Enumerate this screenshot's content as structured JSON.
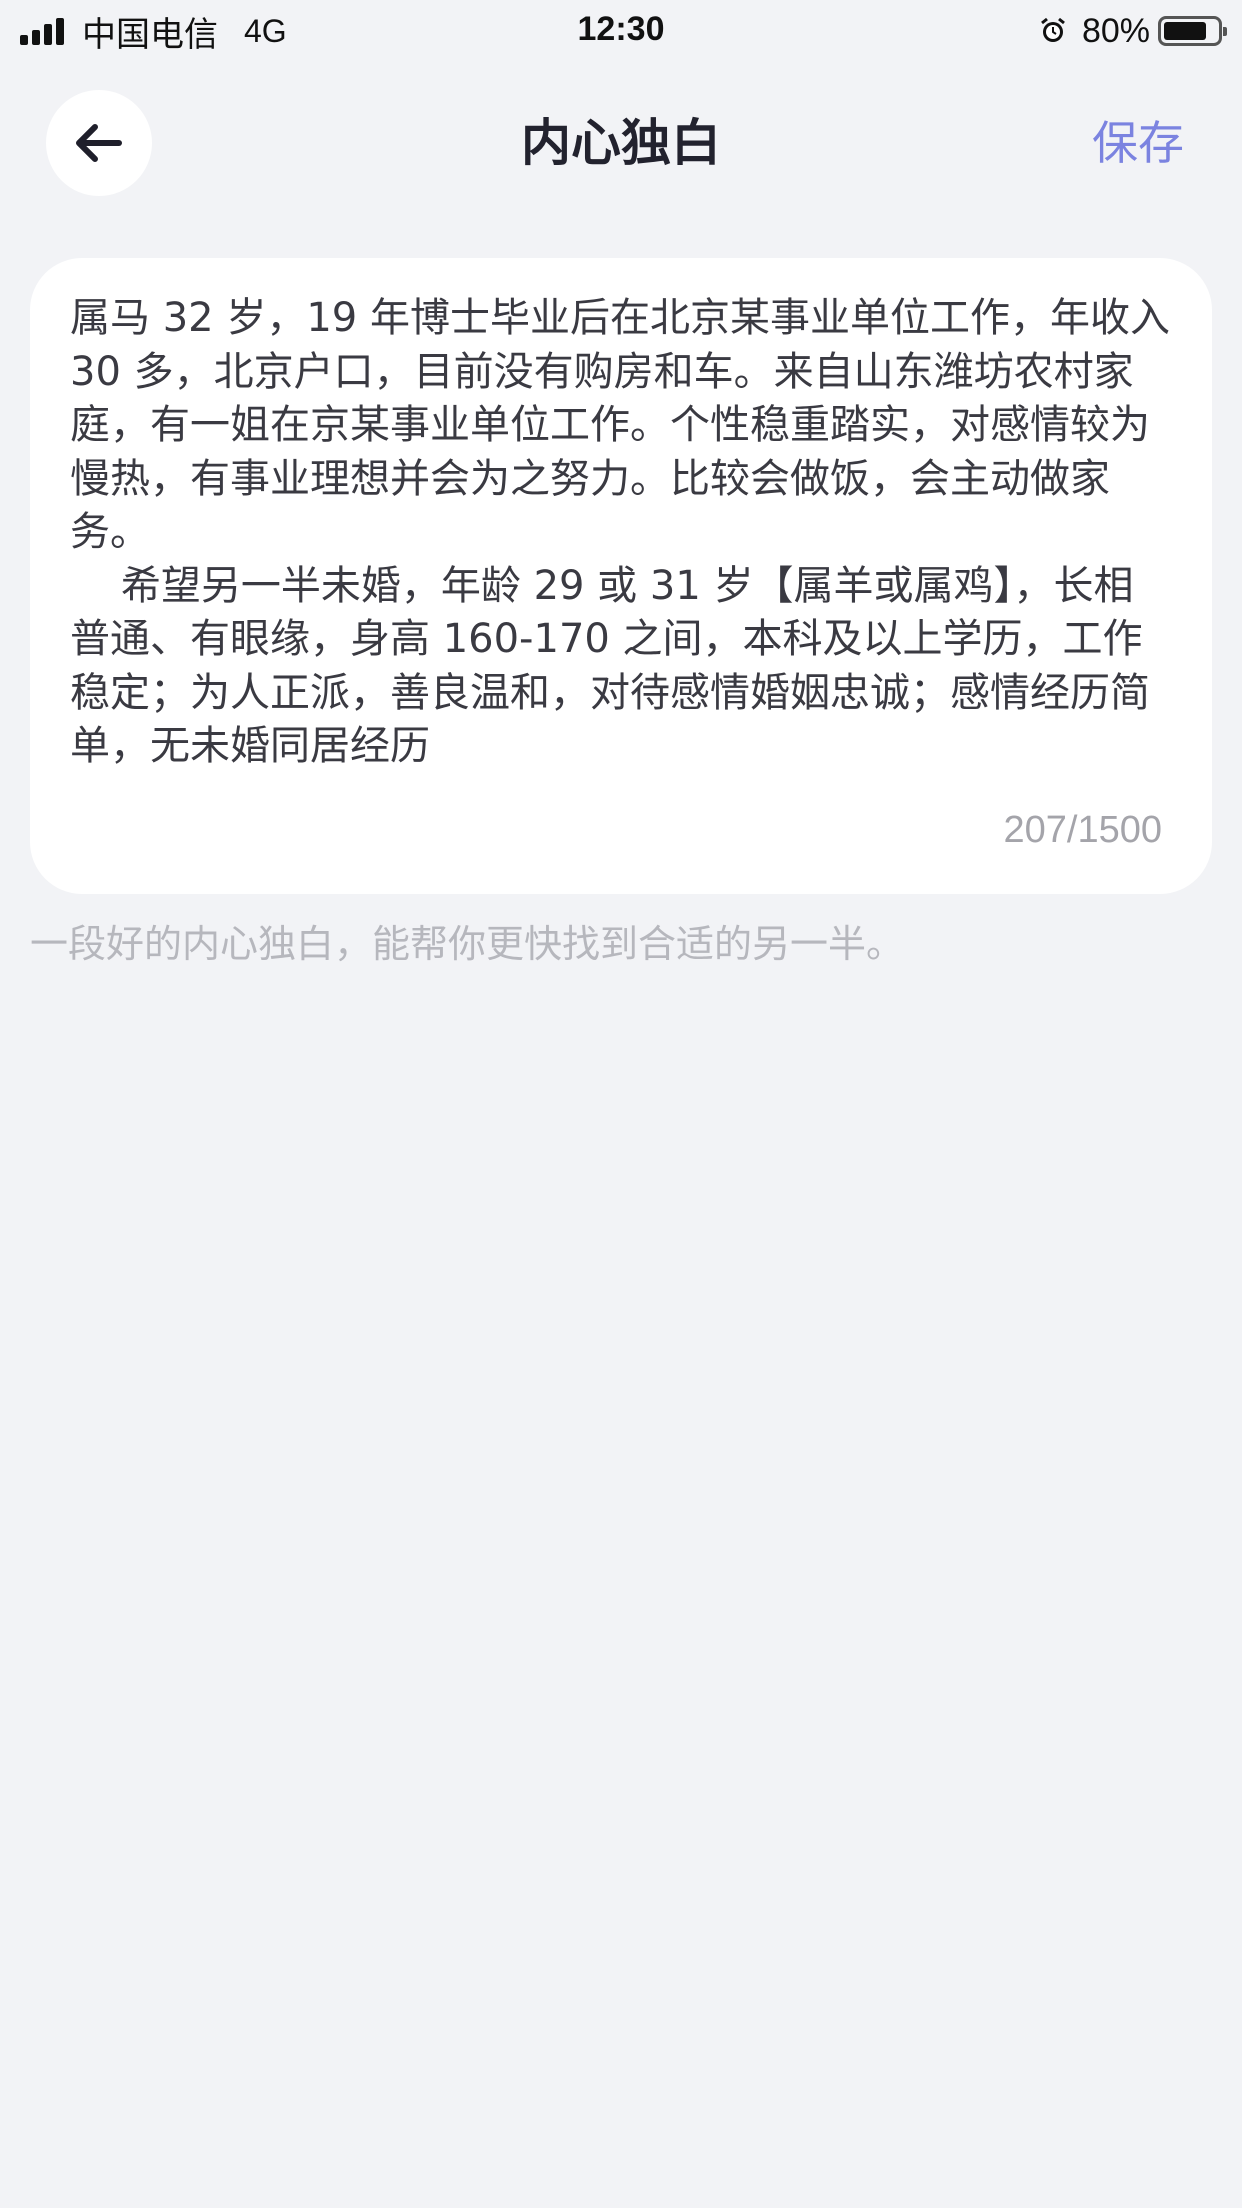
{
  "status_bar": {
    "carrier": "中国电信",
    "network": "4G",
    "time": "12:30",
    "battery_percent": "80%",
    "battery_level": 0.8,
    "alarm_icon": "alarm-clock-icon",
    "signal_icon": "signal-bars-icon"
  },
  "header": {
    "back_icon": "arrow-left-icon",
    "title": "内心独白",
    "save_label": "保存"
  },
  "editor": {
    "content": "属马 32 岁，19 年博士毕业后在北京某事业单位工作，年收入 30 多，北京户口，目前没有购房和车。来自山东潍坊农村家庭，有一姐在京某事业单位工作。个性稳重踏实，对感情较为慢热，有事业理想并会为之努力。比较会做饭，会主动做家务。\n    希望另一半未婚，年龄 29 或 31 岁【属羊或属鸡】，长相普通、有眼缘，身高 160-170 之间，本科及以上学历，工作稳定；为人正派，善良温和，对待感情婚姻忠诚；感情经历简单，无未婚同居经历",
    "counter": "207/1500"
  },
  "hint": "一段好的内心独白，能帮你更快找到合适的另一半。",
  "colors": {
    "background": "#f2f3f6",
    "accent": "#7b83e0",
    "card": "#ffffff",
    "hint_text": "#b6b7bd"
  }
}
